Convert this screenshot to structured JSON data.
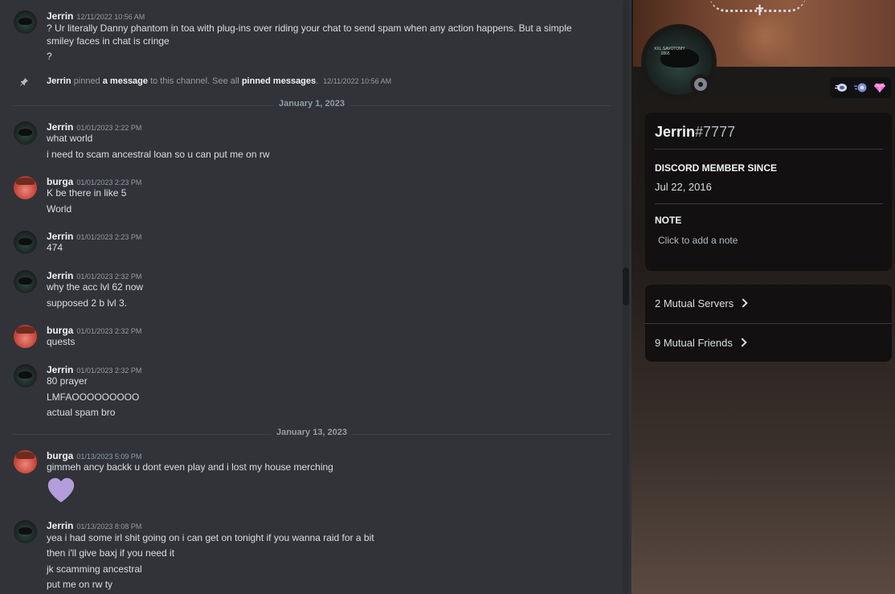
{
  "chat": {
    "pinned": {
      "author": "Jerrin",
      "pre": "pinned",
      "link1": "a message",
      "mid": "to this channel. See all",
      "link2": "pinned messages",
      "post": ".",
      "timestamp": "12/11/2022 10:56 AM"
    },
    "dividers": [
      "January 1, 2023",
      "January 13, 2023"
    ],
    "messages": [
      {
        "author": "Jerrin",
        "timestamp": "12/11/2022 10:56 AM",
        "lines": [
          "? Ur literally Danny phantom in toa with plug-ins over riding your chat to send spam when any action happens. But a simple smiley faces in chat is cringe",
          "?"
        ]
      },
      {
        "author": "Jerrin",
        "timestamp": "01/01/2023 2:22 PM",
        "lines": [
          "what world",
          "i need to scam ancestral loan so u can put me on rw"
        ]
      },
      {
        "author": "burga",
        "timestamp": "01/01/2023 2:23 PM",
        "lines": [
          "K be there in like 5",
          "World"
        ]
      },
      {
        "author": "Jerrin",
        "timestamp": "01/01/2023 2:23 PM",
        "lines": [
          "474"
        ]
      },
      {
        "author": "Jerrin",
        "timestamp": "01/01/2023 2:32 PM",
        "lines": [
          "why the acc lvl 62 now",
          "supposed 2 b lvl 3."
        ]
      },
      {
        "author": "burga",
        "timestamp": "01/01/2023 2:32 PM",
        "lines": [
          "quests"
        ]
      },
      {
        "author": "Jerrin",
        "timestamp": "01/01/2023 2:32 PM",
        "lines": [
          "80 prayer",
          "LMFAOOOOOOOOO",
          "actual spam bro"
        ]
      },
      {
        "author": "burga",
        "timestamp": "01/13/2023 5:09 PM",
        "lines": [
          "gimmeh ancy backk u dont even play and i lost my house merching"
        ],
        "emoji": "purple-heart"
      },
      {
        "author": "Jerrin",
        "timestamp": "01/13/2023 8:08 PM",
        "lines": [
          "yea i had some irl shit going on i can get on tonight if you wanna raid for a bit",
          "then i'll give baxj if you need it",
          "jk scamming ancestral",
          "put me on rw ty"
        ]
      }
    ]
  },
  "profile": {
    "avatar_caption": "XXL.SAVOTOMY 1865",
    "username": "Jerrin",
    "discriminator": "#7777",
    "member_since_title": "DISCORD MEMBER SINCE",
    "member_since": "Jul 22, 2016",
    "note_title": "NOTE",
    "note_placeholder": "Click to add a note",
    "mutual_servers": "2 Mutual Servers",
    "mutual_friends": "9 Mutual Friends",
    "badges": [
      "nitro-badge",
      "boost-badge",
      "gem-badge"
    ],
    "status": "offline"
  },
  "colors": {
    "chat_bg": "#313338",
    "heart": "#b39ddb",
    "card_bg": "#121010"
  }
}
